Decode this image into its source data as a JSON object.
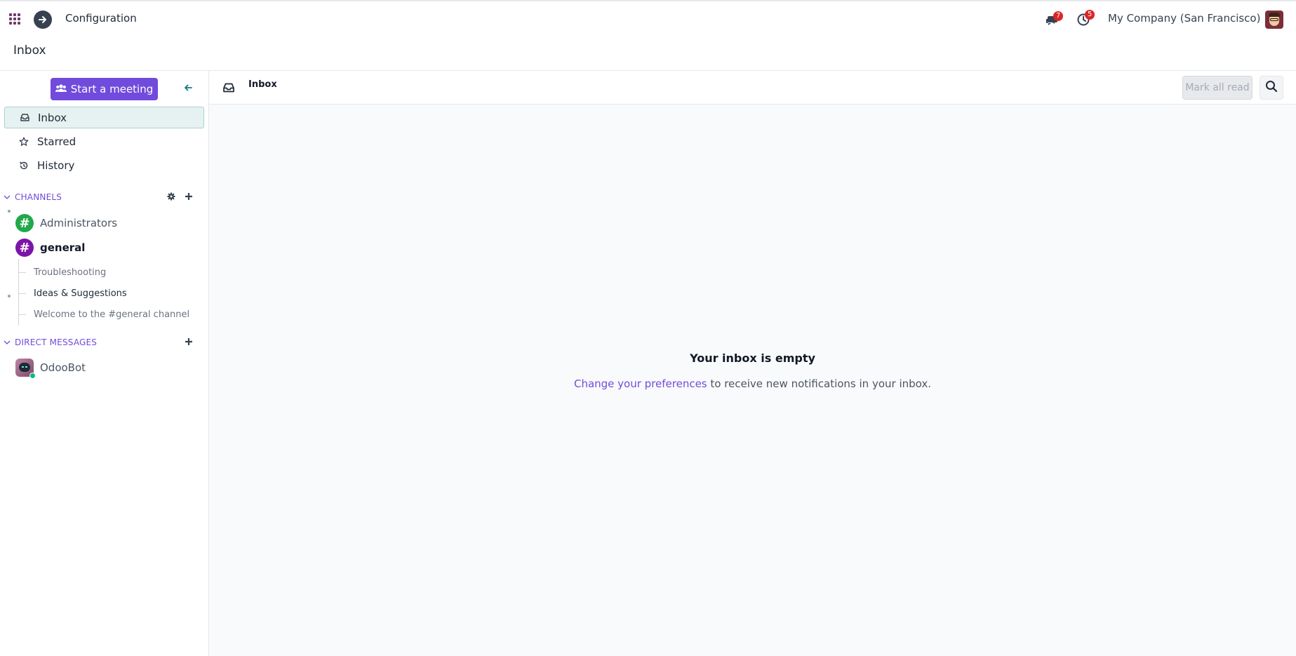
{
  "navbar": {
    "app_title": "Configuration",
    "messages_count": "7",
    "activities_count": "5",
    "company": "My Company (San Francisco)"
  },
  "breadcrumb": "Inbox",
  "sidebar": {
    "meeting_button": "Start a meeting",
    "items": [
      {
        "label": "Inbox",
        "icon": "inbox-icon"
      },
      {
        "label": "Starred",
        "icon": "star-icon"
      },
      {
        "label": "History",
        "icon": "history-icon"
      }
    ],
    "channels_header": "CHANNELS",
    "channels": [
      {
        "label": "Administrators",
        "color": "#22a849"
      },
      {
        "label": "general",
        "color": "#7c14a8"
      }
    ],
    "threads": [
      {
        "label": "Troubleshooting"
      },
      {
        "label": "Ideas & Suggestions"
      },
      {
        "label": "Welcome to the #general channel"
      }
    ],
    "dm_header": "DIRECT MESSAGES",
    "direct_messages": [
      {
        "label": "OdooBot"
      }
    ]
  },
  "main": {
    "title": "Inbox",
    "mark_all_read": "Mark all read",
    "empty_title": "Your inbox is empty",
    "empty_link": "Change your preferences",
    "empty_text": " to receive new notifications in your inbox."
  },
  "colors": {
    "accent": "#714bdc",
    "brand": "#71396b",
    "active_bg": "#e6f2f1",
    "badge": "#dc2626"
  }
}
